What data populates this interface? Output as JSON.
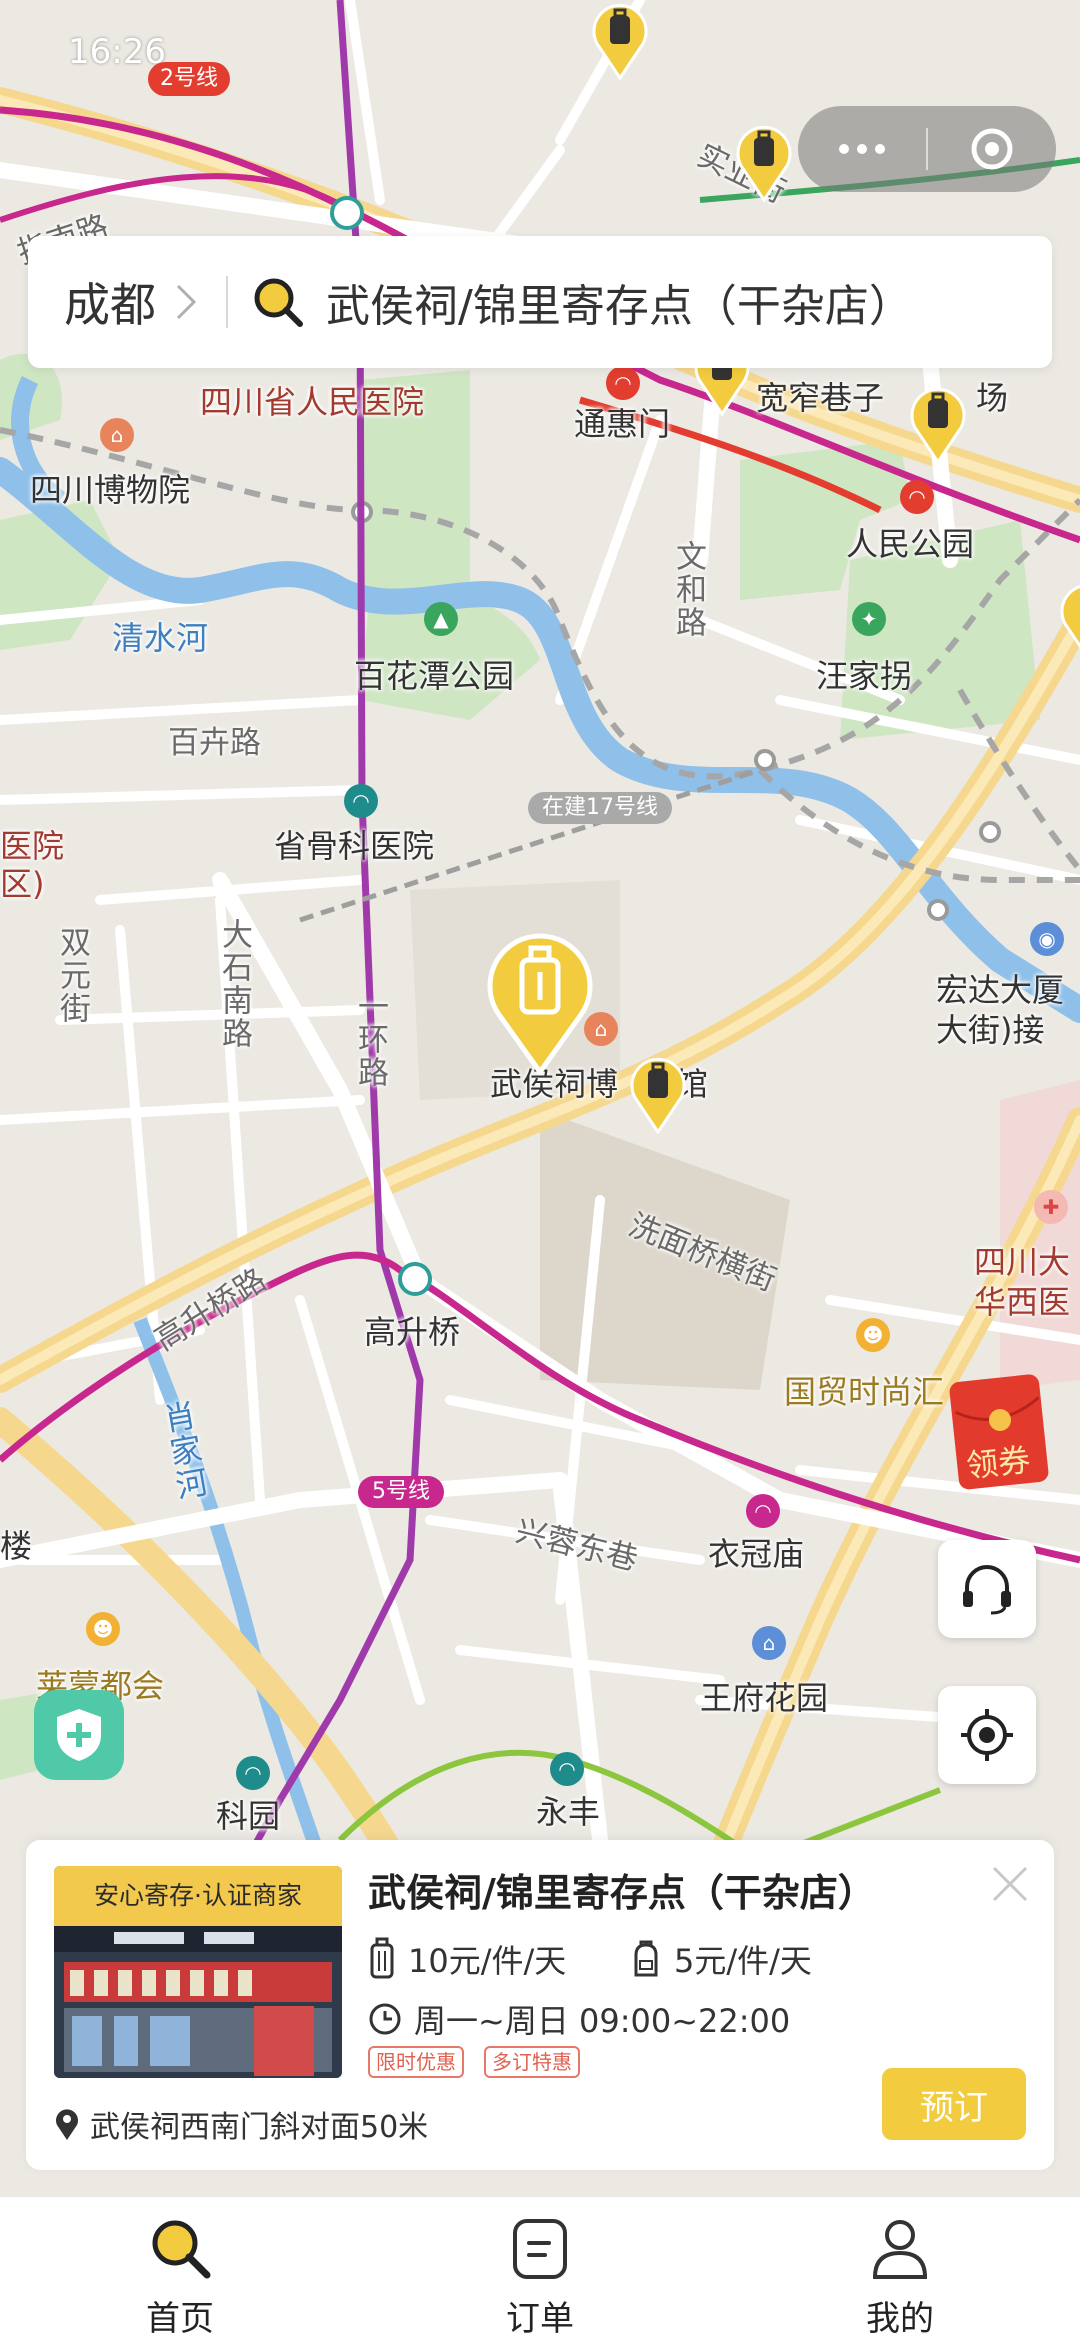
{
  "status_bar": {
    "time": "16:26"
  },
  "header": {
    "city": "成都",
    "search_text": "武侯祠/锦里寄存点（干杂店）",
    "icons": [
      "chevron-right-icon",
      "search-icon",
      "more-icon",
      "close-circle-icon"
    ]
  },
  "map": {
    "metro_badges": {
      "line2": "2号线",
      "line5": "5号线",
      "line17": "在建17号线"
    },
    "places": {
      "people_hospital": "四川省人民医院",
      "museum": "四川博物院",
      "tonghuimen": "通惠门",
      "kuanzhai": "宽窄巷子",
      "kuanzhai_tail": "场",
      "people_park": "人民公园",
      "wenhe_road": "文和路",
      "wangjiaguai": "汪家拐",
      "qingshui_river": "清水河",
      "baihuatan_park": "百花潭公园",
      "baihui_road": "百卉路",
      "bone_hospital": "省骨科医院",
      "hospital_cut": "医院",
      "district_cut": "区)",
      "shuangyuan": "双元街",
      "dashi_south": "大石南路",
      "ring1": "一环路",
      "wuhouci_museum_a": "武侯祠博",
      "wuhouci_museum_b": "馆",
      "hongda_a": "宏达大厦",
      "hongda_b": "大街)接",
      "ximian_bridge": "洗面桥横街",
      "gaosheng_road": "高升桥路",
      "gaosheng_bridge": "高升桥",
      "sichuan_west_a": "四川大",
      "sichuan_west_b": "华西医",
      "guomao": "国贸时尚汇",
      "xiaojia_river": "肖家河",
      "xingrong": "兴蓉东巷",
      "yiguan": "衣冠庙",
      "lou": "楼",
      "laimeng": "莱蒙都会",
      "wangfu": "王府花园",
      "keyuan": "科园",
      "yongfeng": "永丰",
      "shiyi_road": "实业街",
      "dongjie": "指南路"
    }
  },
  "coupon": {
    "label": "领券"
  },
  "store_card": {
    "badge": "安心寄存·认证商家",
    "name": "武侯祠/锦里寄存点（干杂店）",
    "price_large": "10元/件/天",
    "price_small": "5元/件/天",
    "hours": "周一~周日 09:00~22:00",
    "tags": [
      "限时优惠",
      "多订特惠"
    ],
    "address": "武侯祠西南门斜对面50米",
    "book_label": "预订"
  },
  "tab_bar": {
    "items": [
      {
        "label": "首页",
        "icon": "search-icon",
        "active": true
      },
      {
        "label": "订单",
        "icon": "order-icon",
        "active": false
      },
      {
        "label": "我的",
        "icon": "user-icon",
        "active": false
      }
    ]
  },
  "colors": {
    "accent": "#F2CC3E",
    "metro_line2": "#E23D2F",
    "metro_line5": "#C8288E",
    "shield": "#4FC9A8",
    "tag": "#E0614F"
  }
}
